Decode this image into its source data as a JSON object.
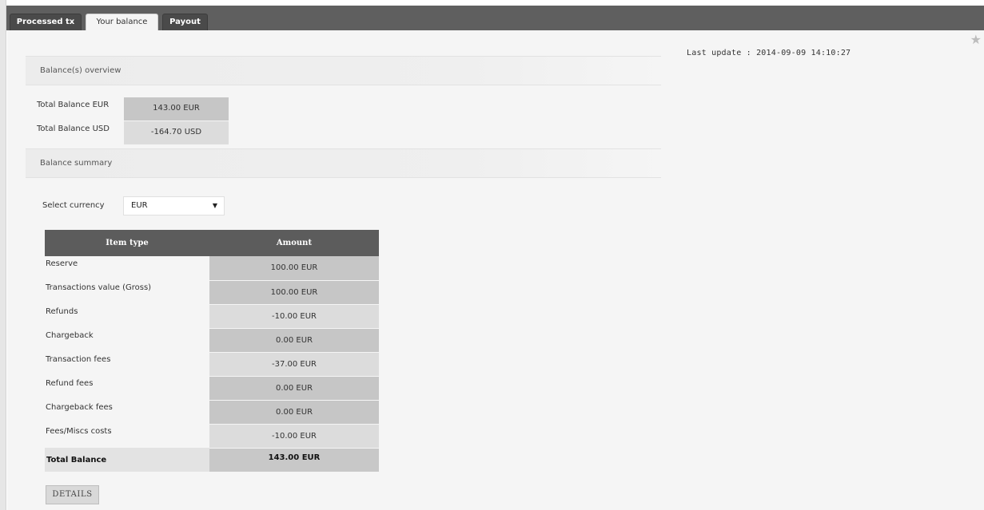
{
  "tabs": [
    {
      "label": "Processed tx",
      "active": false
    },
    {
      "label": "Your balance",
      "active": true
    },
    {
      "label": "Payout",
      "active": false
    }
  ],
  "header": {
    "last_update": "Last update : 2014-09-09 14:10:27",
    "star_icon": "star-icon"
  },
  "balances_overview": {
    "title": "Balance(s) overview",
    "rows": [
      {
        "label": "Total Balance EUR",
        "value": "143.00 EUR"
      },
      {
        "label": "Total Balance USD",
        "value": "-164.70 USD"
      }
    ]
  },
  "balance_summary": {
    "title": "Balance summary",
    "currency_label": "Select currency",
    "currency_value": "EUR",
    "table": {
      "headers": [
        "Item type",
        "Amount"
      ],
      "rows": [
        {
          "type": "Reserve",
          "amount": "100.00 EUR"
        },
        {
          "type": "Transactions value (Gross)",
          "amount": "100.00 EUR"
        },
        {
          "type": "Refunds",
          "amount": "-10.00 EUR"
        },
        {
          "type": "Chargeback",
          "amount": "0.00 EUR"
        },
        {
          "type": "Transaction fees",
          "amount": "-37.00 EUR"
        },
        {
          "type": "Refund fees",
          "amount": "0.00 EUR"
        },
        {
          "type": "Chargeback fees",
          "amount": "0.00 EUR"
        },
        {
          "type": "Fees/Miscs costs",
          "amount": "-10.00 EUR"
        }
      ],
      "total": {
        "type": "Total Balance",
        "amount": "143.00 EUR"
      }
    },
    "details_button": "DETAILS"
  },
  "colors": {
    "topbar": "#5f5f5f",
    "table_header": "#5c5c5c",
    "content_bg": "#f5f5f5"
  }
}
